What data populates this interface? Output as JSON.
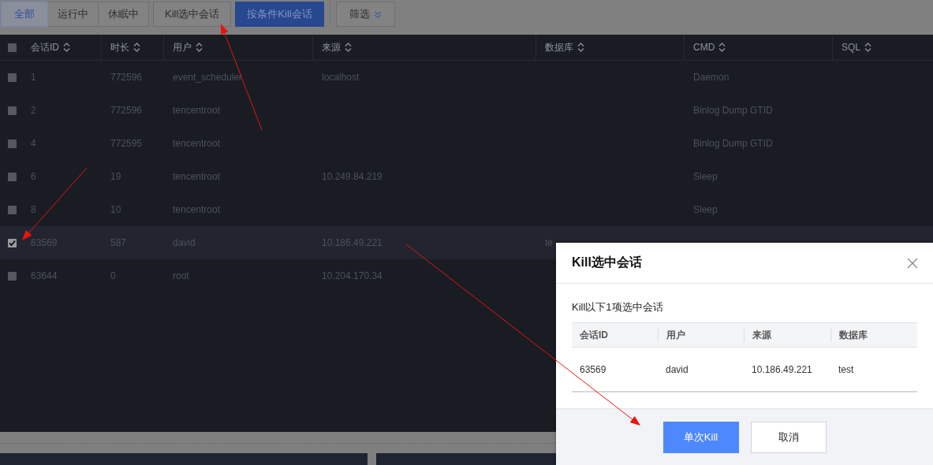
{
  "toolbar": {
    "filter_tabs": [
      {
        "label": "全部",
        "selected": true
      },
      {
        "label": "运行中",
        "selected": false
      },
      {
        "label": "休眠中",
        "selected": false
      }
    ],
    "buttons": [
      {
        "label": "Kill选中会话",
        "kind": "default"
      },
      {
        "label": "按条件Kill会话",
        "kind": "primary"
      }
    ],
    "filter": {
      "label": "筛选"
    }
  },
  "table": {
    "select_all": {
      "checked": false
    },
    "columns": [
      "会话ID",
      "时长",
      "用户",
      "来源",
      "数据库",
      "CMD",
      "SQL"
    ],
    "rows": [
      {
        "checked": false,
        "id": "1",
        "duration": "772596",
        "user": "event_scheduler",
        "source": "localhost",
        "cmd": "Daemon"
      },
      {
        "checked": false,
        "id": "2",
        "duration": "772596",
        "user": "tencentroot",
        "cmd": "Binlog Dump GTID"
      },
      {
        "checked": false,
        "id": "4",
        "duration": "772595",
        "user": "tencentroot",
        "cmd": "Binlog Dump GTID"
      },
      {
        "checked": false,
        "id": "6",
        "duration": "19",
        "user": "tencentroot",
        "source": "10.249.84.219",
        "cmd": "Sleep"
      },
      {
        "checked": false,
        "id": "8",
        "duration": "10",
        "user": "tencentroot",
        "cmd": "Sleep"
      },
      {
        "checked": true,
        "id": "63569",
        "duration": "587",
        "user": "david",
        "source": "10.186.49.221",
        "database": "te"
      },
      {
        "checked": false,
        "id": "63644",
        "duration": "0",
        "user": "root",
        "source": "10.204.170.34"
      }
    ]
  },
  "dialog": {
    "title": "Kill选中会话",
    "message": "Kill以下1项选中会话",
    "table": {
      "columns": [
        "会话ID",
        "用户",
        "来源",
        "数据库"
      ],
      "rows": [
        [
          "63569",
          "david",
          "10.186.49.221",
          "test"
        ]
      ]
    },
    "buttons": [
      {
        "label": "单次Kill",
        "kind": "primary"
      },
      {
        "label": "取消",
        "kind": "default"
      }
    ]
  }
}
